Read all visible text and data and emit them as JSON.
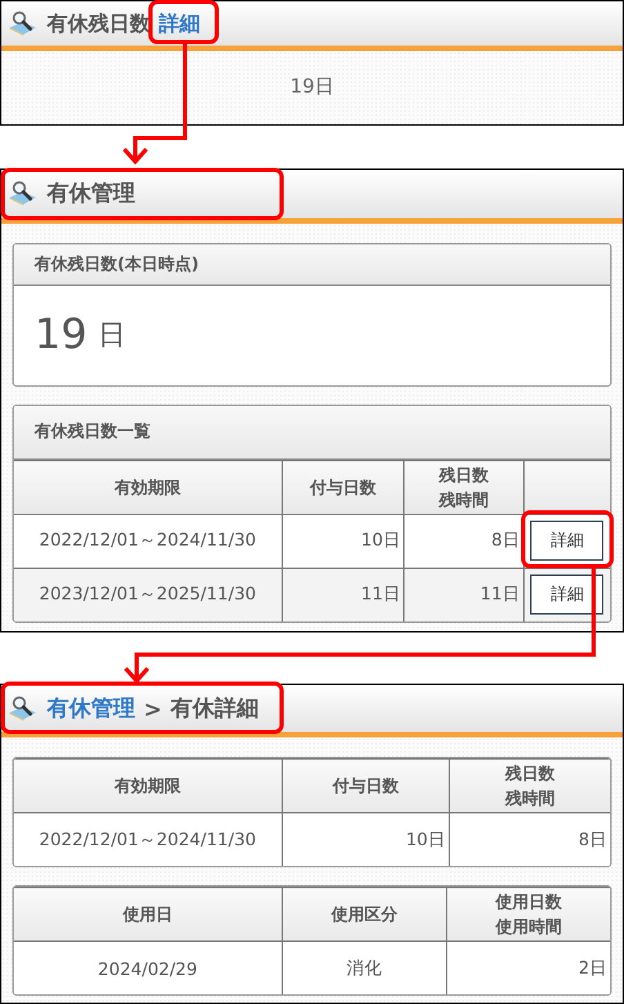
{
  "summary_panel": {
    "title": "有休残日数",
    "link": "詳細",
    "value": "19日"
  },
  "management_panel": {
    "title": "有休管理",
    "balance_card": {
      "title": "有休残日数(本日時点)",
      "number": "19",
      "unit": "日"
    },
    "list_card": {
      "title": "有休残日数一覧",
      "columns": [
        {
          "label": "有効期限",
          "wrapped": false
        },
        {
          "label": "付与日数",
          "wrapped": false
        },
        {
          "label": "残日数残時間",
          "wrapped": true
        }
      ],
      "rows": [
        {
          "period": "2022/12/01～2024/11/30",
          "granted": "10日",
          "remaining": "8日",
          "button": "詳細"
        },
        {
          "period": "2023/12/01～2025/11/30",
          "granted": "11日",
          "remaining": "11日",
          "button": "詳細"
        }
      ]
    }
  },
  "detail_panel": {
    "breadcrumb": [
      {
        "kind": "link",
        "label": "有休管理"
      },
      {
        "kind": "separator",
        "label": ">"
      },
      {
        "kind": "current",
        "label": "有休詳細"
      }
    ],
    "grant_table": {
      "columns": [
        {
          "label": "有効期限",
          "wrapped": false
        },
        {
          "label": "付与日数",
          "wrapped": false
        },
        {
          "label": "残日数残時間",
          "wrapped": true
        }
      ],
      "rows": [
        [
          "2022/12/01～2024/11/30",
          "10日",
          "8日"
        ]
      ]
    },
    "usage_table": {
      "columns": [
        {
          "label": "使用日",
          "wrapped": false
        },
        {
          "label": "使用区分",
          "wrapped": false
        },
        {
          "label": "使用日数使用時間",
          "wrapped": true
        }
      ],
      "rows": [
        [
          "2024/02/29",
          "消化",
          "2日"
        ]
      ]
    }
  }
}
